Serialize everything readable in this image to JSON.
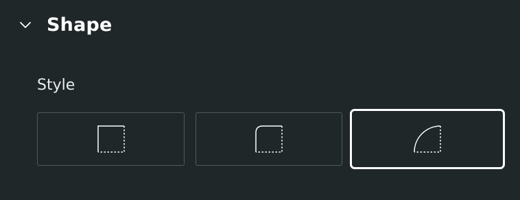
{
  "section": {
    "title": "Shape",
    "expanded": true,
    "toggle_icon": "chevron-down-icon"
  },
  "style": {
    "label": "Style",
    "options": [
      {
        "icon": "square-corner-icon",
        "selected": false
      },
      {
        "icon": "small-radius-corner-icon",
        "selected": false
      },
      {
        "icon": "large-radius-corner-icon",
        "selected": true
      }
    ]
  },
  "colors": {
    "background": "#1f2729",
    "button_border": "#4f5b5d",
    "selected_border": "#ffffff",
    "text": "#ffffff"
  }
}
